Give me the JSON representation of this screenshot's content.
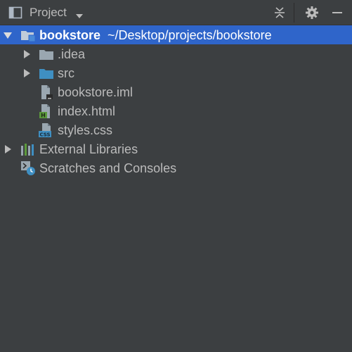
{
  "header": {
    "view_label": "Project",
    "view_icon": "project-view-icon",
    "caret_icon": "chevron-down-icon",
    "collapse_icon": "collapse-all-icon",
    "settings_icon": "gear-icon",
    "hide_icon": "minimize-icon"
  },
  "tree": {
    "root": {
      "name": "bookstore",
      "path": "~/Desktop/projects/bookstore",
      "expanded": true,
      "selected": true
    },
    "children": [
      {
        "name": ".idea",
        "type": "folder",
        "expanded": false
      },
      {
        "name": "src",
        "type": "source-folder",
        "expanded": false
      },
      {
        "name": "bookstore.iml",
        "type": "iml-file"
      },
      {
        "name": "index.html",
        "type": "html-file"
      },
      {
        "name": "styles.css",
        "type": "css-file"
      }
    ],
    "external_libraries": {
      "name": "External Libraries",
      "expanded": false
    },
    "scratches": {
      "name": "Scratches and Consoles"
    }
  },
  "colors": {
    "background": "#3c3f41",
    "selection": "#2f65ca",
    "text": "#bbbbbb",
    "selected_text": "#ffffff"
  }
}
